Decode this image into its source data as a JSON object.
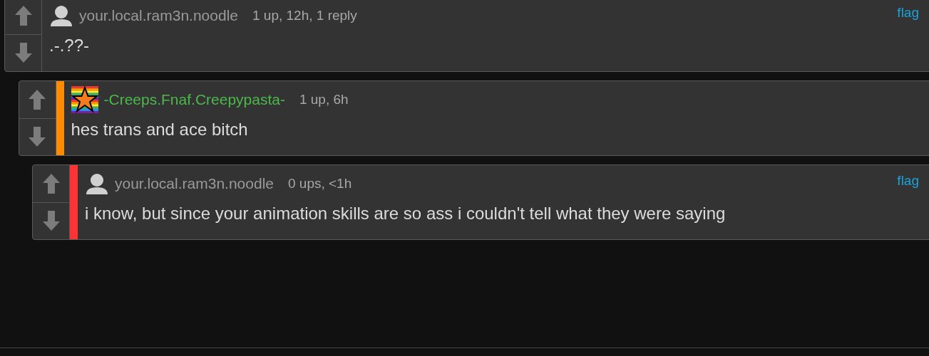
{
  "comments": [
    {
      "kind": "silhouette",
      "user": {
        "name": "your.local.ram3n.noodle",
        "color": "#9a9a9a"
      },
      "meta": "1 up, 12h, 1 reply",
      "flag": "flag",
      "text": ".-.??-",
      "children": [
        {
          "kind": "star",
          "user": {
            "name": "-Creeps.Fnaf.Creepypasta-",
            "color": "#4cb84c"
          },
          "color": "#ff8c00",
          "meta": "1 up, 6h",
          "text": "hes trans and ace bitch",
          "children": [
            {
              "kind": "silhouette",
              "user": {
                "name": "your.local.ram3n.noodle",
                "color": "#9a9a9a"
              },
              "color": "#ff3333",
              "meta": "0 ups, <1h",
              "flag": "flag",
              "text": "i know, but since your animation skills are so ass i couldn't tell what they were saying"
            }
          ]
        }
      ]
    }
  ]
}
